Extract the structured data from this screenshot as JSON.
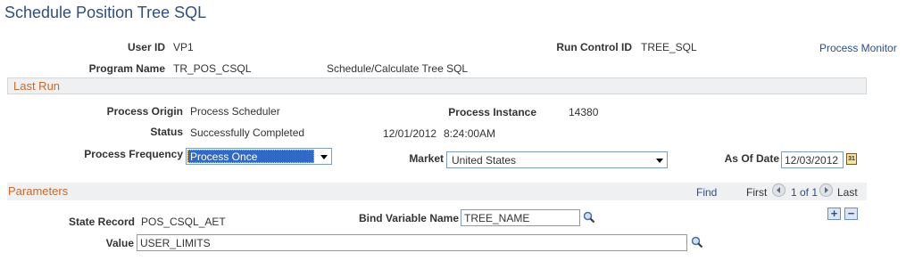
{
  "page": {
    "title": "Schedule Position Tree SQL"
  },
  "header": {
    "user_id_label": "User ID",
    "user_id_value": "VP1",
    "run_control_label": "Run Control ID",
    "run_control_value": "TREE_SQL",
    "process_monitor_link": "Process Monitor",
    "program_name_label": "Program Name",
    "program_name_value": "TR_POS_CSQL",
    "program_description": "Schedule/Calculate Tree SQL"
  },
  "last_run": {
    "section_title": "Last Run",
    "origin_label": "Process Origin",
    "origin_value": "Process Scheduler",
    "instance_label": "Process Instance",
    "instance_value": "14380",
    "status_label": "Status",
    "status_value": "Successfully Completed",
    "date_value": "12/01/2012",
    "time_value": "8:24:00AM",
    "frequency_label": "Process Frequency",
    "frequency_selected": "Process Once",
    "market_label": "Market",
    "market_selected": "United States",
    "as_of_date_label": "As Of Date",
    "as_of_date_value": "12/03/2012",
    "calendar_icon_text": "31"
  },
  "parameters": {
    "section_title": "Parameters",
    "find_link": "Find",
    "first_label": "First",
    "page_info": "1 of 1",
    "last_label": "Last",
    "state_record_label": "State Record",
    "state_record_value": "POS_CSQL_AET",
    "bind_variable_label": "Bind Variable Name",
    "bind_variable_value": "TREE_NAME",
    "value_label": "Value",
    "value_value": "USER_LIMITS",
    "add_symbol": "+",
    "remove_symbol": "−"
  },
  "colors": {
    "title": "#2f4f80",
    "section_header": "#c76b2b",
    "link": "#2a4f8a",
    "selected_option_bg": "#3169c6",
    "bar_bg": "#eef0f2"
  },
  "icons": [
    "lookup-icon",
    "calendar-icon",
    "nav-prev-icon",
    "nav-next-icon",
    "add-row-icon",
    "delete-row-icon"
  ]
}
